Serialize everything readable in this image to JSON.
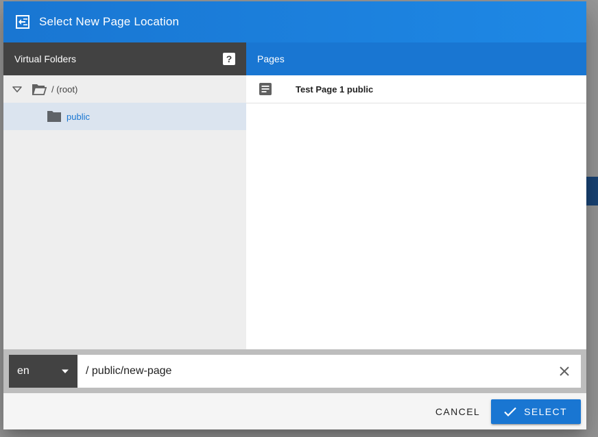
{
  "dialog": {
    "title": "Select New Page Location",
    "title_icon": "move-to-inbox-icon"
  },
  "folders_pane": {
    "header": "Virtual Folders",
    "help_icon": "help-icon",
    "help_glyph": "?",
    "tree": [
      {
        "label": "/ (root)",
        "icon": "folder-open-icon",
        "expanded": true
      },
      {
        "label": "public",
        "icon": "folder-icon",
        "selected": true
      }
    ]
  },
  "pages_pane": {
    "header": "Pages",
    "items": [
      {
        "title": "Test Page 1 public",
        "icon": "document-icon"
      }
    ]
  },
  "path_bar": {
    "locale": "en",
    "path_value": "/ public/new-page"
  },
  "actions": {
    "cancel_label": "CANCEL",
    "select_label": "SELECT"
  },
  "colors": {
    "primary": "#1976d2",
    "header_dark": "#424242",
    "selected_row": "#dbe4ef"
  }
}
